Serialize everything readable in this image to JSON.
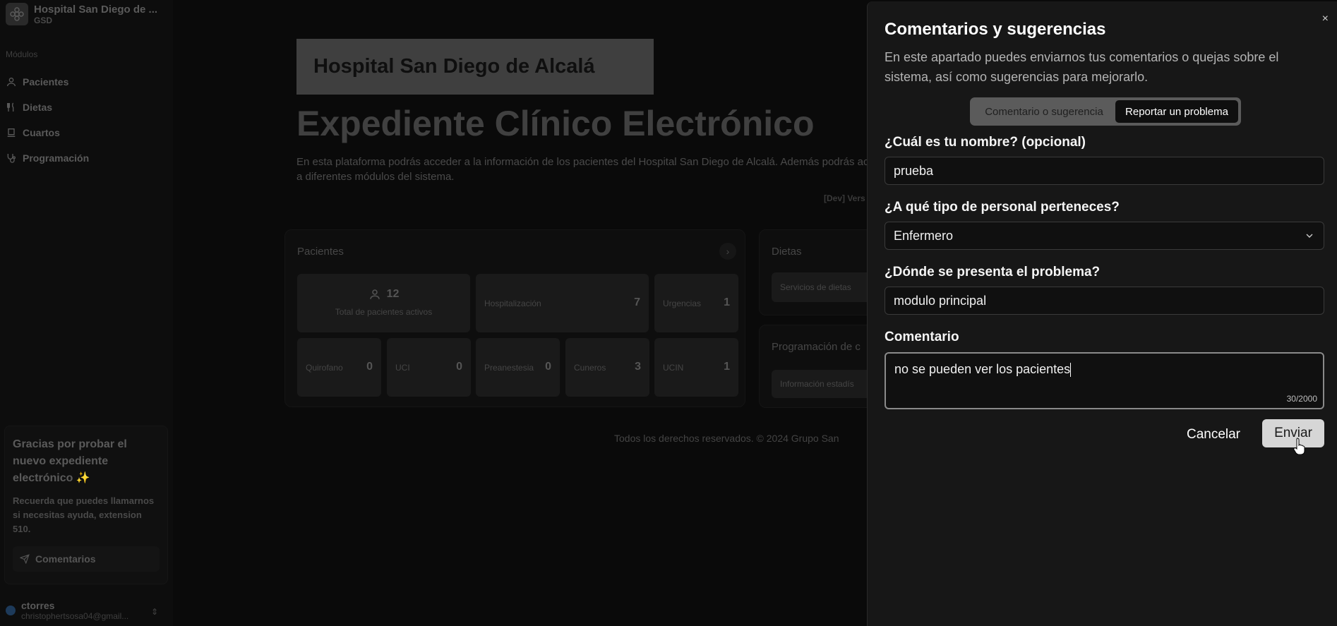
{
  "sidebar": {
    "brand_name": "Hospital San Diego de ...",
    "brand_sub": "GSD",
    "section_label": "Módulos",
    "items": [
      {
        "label": "Pacientes",
        "icon": "user-icon"
      },
      {
        "label": "Dietas",
        "icon": "utensils-icon"
      },
      {
        "label": "Cuartos",
        "icon": "bed-icon"
      },
      {
        "label": "Programación",
        "icon": "stethoscope-icon"
      }
    ],
    "promo": {
      "title": "Gracias por probar el nuevo expediente electrónico ✨",
      "text": "Recuerda que puedes llamarnos si necesitas ayuda, extension 510.",
      "button": "Comentarios"
    },
    "user": {
      "name": "ctorres",
      "email": "christophertsosa04@gmail..."
    }
  },
  "main": {
    "hero_box": "Hospital San Diego de Alcalá",
    "title": "Expediente Clínico Electrónico",
    "intro": "En esta plataforma podrás acceder a la información de los pacientes del Hospital San Diego de Alcalá. Además podrás acceder a diferentes módulos del sistema.",
    "version": "[Dev] Vers",
    "patients_card": {
      "title": "Pacientes",
      "total": "12",
      "total_label": "Total de pacientes activos",
      "tiles": [
        {
          "label": "Hospitalización",
          "value": "7"
        },
        {
          "label": "Urgencias",
          "value": "1"
        },
        {
          "label": "Quirofano",
          "value": "0"
        },
        {
          "label": "UCI",
          "value": "0"
        },
        {
          "label": "Preanestesia",
          "value": "0"
        },
        {
          "label": "Cuneros",
          "value": "3"
        },
        {
          "label": "UCIN",
          "value": "1"
        }
      ]
    },
    "diets_card": {
      "title": "Dietas",
      "tile": "Servicios de dietas"
    },
    "schedule_card": {
      "title": "Programación de c",
      "tile": "Información estadís"
    },
    "footer": "Todos los derechos reservados. © 2024 Grupo San"
  },
  "dialog": {
    "title": "Comentarios y sugerencias",
    "description": "En este apartado puedes enviarnos tus comentarios o quejas sobre el sistema, así como sugerencias para mejorarlo.",
    "tabs": [
      "Comentario o sugerencia",
      "Reportar un problema"
    ],
    "active_tab": "Reportar un problema",
    "name_label": "¿Cuál es tu nombre? (opcional)",
    "name_value": "prueba",
    "staff_label": "¿A qué tipo de personal perteneces?",
    "staff_value": "Enfermero",
    "location_label": "¿Dónde se presenta el problema?",
    "location_value": "modulo principal",
    "comment_label": "Comentario",
    "comment_value": "no se pueden ver los pacientes",
    "counter": "30/2000",
    "cancel": "Cancelar",
    "send": "Enviar",
    "close": "×"
  }
}
